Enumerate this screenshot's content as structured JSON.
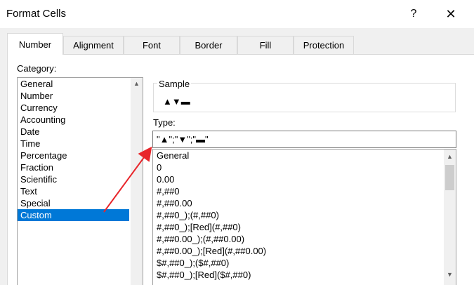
{
  "window": {
    "title": "Format Cells",
    "help_glyph": "?",
    "close_glyph": "✕"
  },
  "tabs": [
    "Number",
    "Alignment",
    "Font",
    "Border",
    "Fill",
    "Protection"
  ],
  "active_tab": "Number",
  "category": {
    "label": "Category:",
    "items": [
      "General",
      "Number",
      "Currency",
      "Accounting",
      "Date",
      "Time",
      "Percentage",
      "Fraction",
      "Scientific",
      "Text",
      "Special",
      "Custom"
    ],
    "selected": "Custom"
  },
  "sample": {
    "label": "Sample",
    "value": "▲▼▬"
  },
  "type": {
    "label": "Type:",
    "value": "\"▲\";\"▼\";\"▬\"",
    "items": [
      "General",
      "0",
      "0.00",
      "#,##0",
      "#,##0.00",
      "#,##0_);(#,##0)",
      "#,##0_);[Red](#,##0)",
      "#,##0.00_);(#,##0.00)",
      "#,##0.00_);[Red](#,##0.00)",
      "$#,##0_);($#,##0)",
      "$#,##0_);[Red]($#,##0)"
    ]
  },
  "colors": {
    "selection": "#0078d7",
    "annotation_arrow": "#e8262b"
  },
  "icons": {
    "scroll_up": "▲",
    "scroll_down": "▼"
  }
}
